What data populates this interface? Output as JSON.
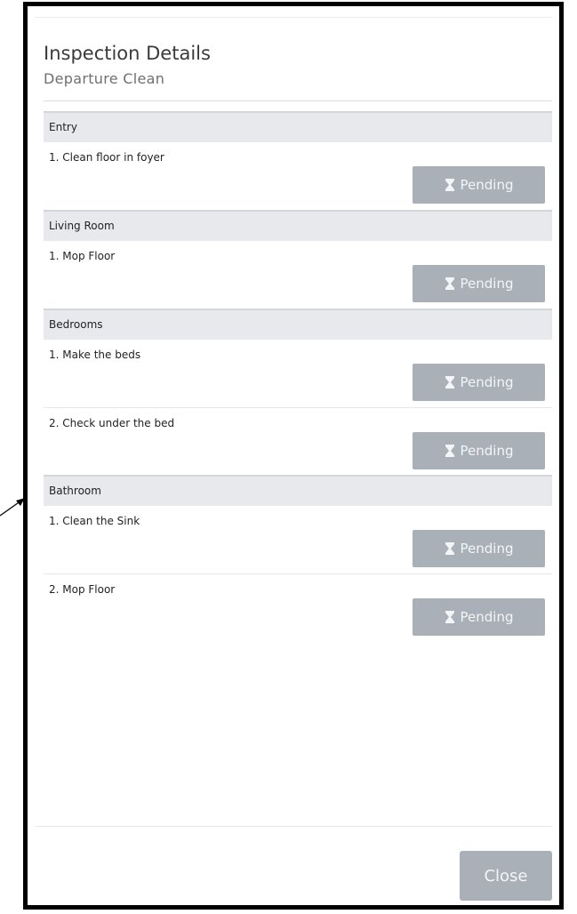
{
  "dialog": {
    "title": "Inspection Details",
    "subtitle": "Departure Clean",
    "close_label": "Close"
  },
  "sections": [
    {
      "name": "Entry",
      "items": [
        {
          "label": "1. Clean floor in foyer",
          "status": "Pending"
        }
      ]
    },
    {
      "name": "Living Room",
      "items": [
        {
          "label": "1. Mop Floor",
          "status": "Pending"
        }
      ]
    },
    {
      "name": "Bedrooms",
      "items": [
        {
          "label": "1. Make the beds",
          "status": "Pending"
        },
        {
          "label": "2. Check under the bed",
          "status": "Pending"
        }
      ]
    },
    {
      "name": "Bathroom",
      "items": [
        {
          "label": "1. Clean the Sink",
          "status": "Pending"
        },
        {
          "label": "2. Mop Floor",
          "status": "Pending"
        }
      ]
    }
  ],
  "icons": {
    "status": "hourglass-icon"
  },
  "colors": {
    "button_bg": "#a9b0b8",
    "section_bg": "#e8e9ec"
  }
}
